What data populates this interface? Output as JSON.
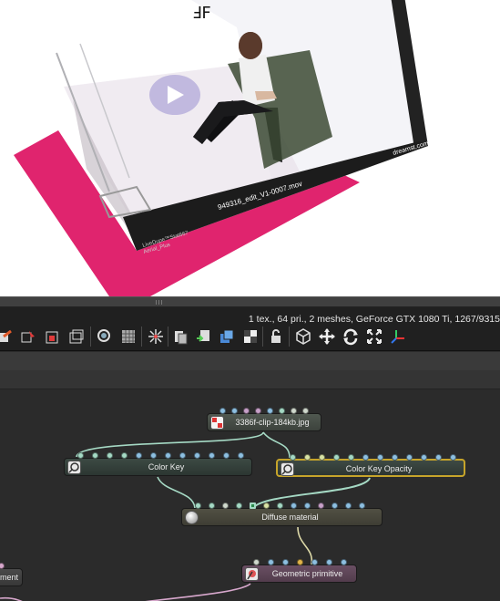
{
  "viewport": {
    "video_filename": "949316_edit_V1-0007.mov",
    "watermark_right": "dreamst.com",
    "watermark_left_line1": "LiveDupe™Stat667",
    "watermark_left_line2": "Aerial_Plus",
    "colors": {
      "plane": "#e0246e",
      "card": "#ffffff"
    }
  },
  "toolbar": {
    "stats": "1 tex., 64 pri., 2 meshes, GeForce GTX 1080 Ti, 1267/9315",
    "icons": [
      "paint-icon",
      "cursor-icon",
      "select-icon",
      "layers-icon",
      "magnify-icon",
      "grid-icon",
      "sparkle-icon",
      "copy-icon",
      "import-icon",
      "stack-icon",
      "checker-icon",
      "lock-icon",
      "cube-icon",
      "move-icon",
      "rotate-icon",
      "expand-icon",
      "axes-icon"
    ]
  },
  "graph": {
    "nodes": {
      "clip": {
        "label": "3386f-clip-184kb.jpg"
      },
      "color_key": {
        "label": "Color Key"
      },
      "color_key_opacity": {
        "label": "Color Key Opacity"
      },
      "diffuse": {
        "label": "Diffuse material"
      },
      "geometric": {
        "label": "Geometric primitive"
      },
      "partial": {
        "label": "ment"
      }
    },
    "colors": {
      "wire": "#a5d9c4",
      "wire_pink": "#d7a7cc",
      "selected_border": "#c6a42a"
    }
  }
}
